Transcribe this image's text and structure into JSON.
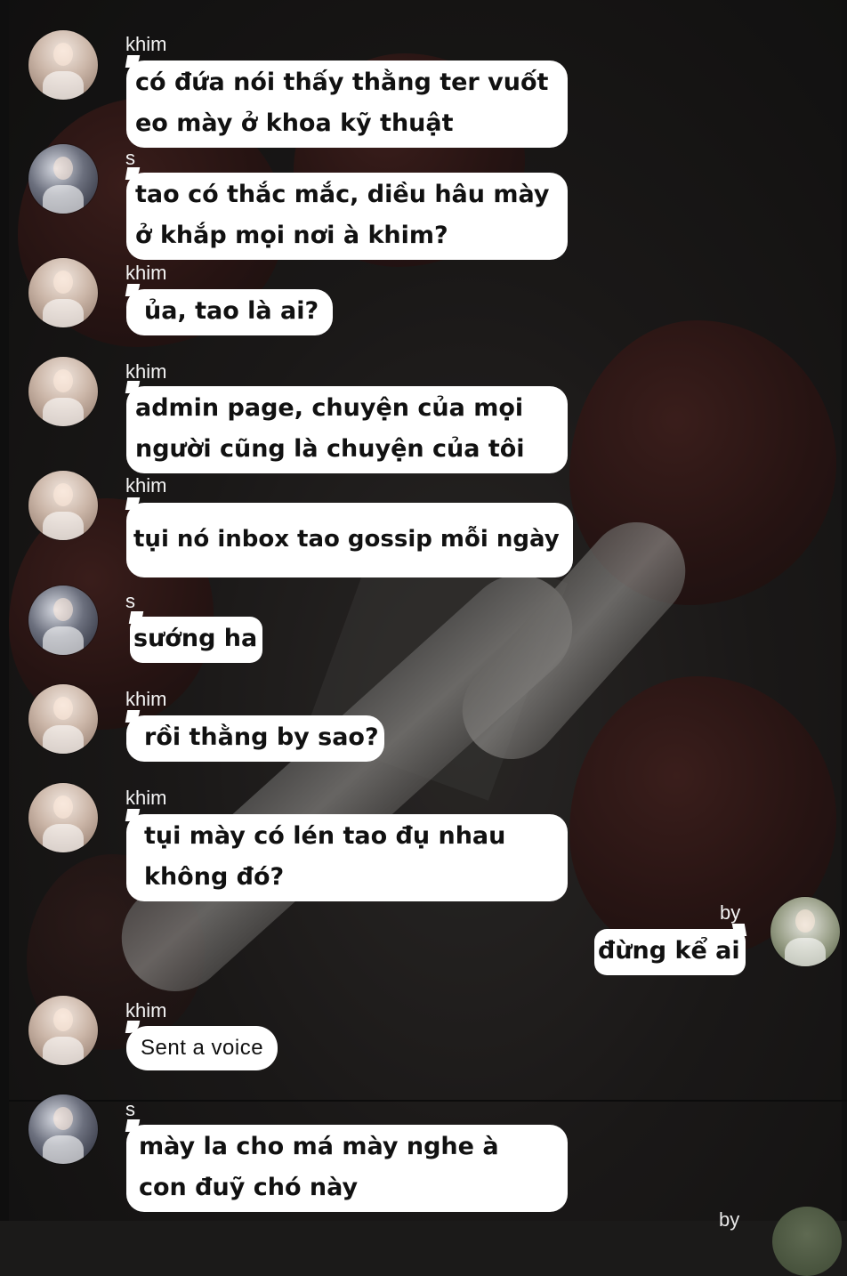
{
  "chat": {
    "messages": [
      {
        "sender": "khim",
        "avatar_icon": "khim-avatar-icon",
        "text": "có đứa nói thấy thằng ter vuốt eo mày ở khoa kỹ thuật",
        "side": "left"
      },
      {
        "sender": "s",
        "avatar_icon": "s-avatar-icon",
        "text": "tao có thắc mắc, diều hâu mày ở khắp mọi nơi à khim?",
        "side": "left"
      },
      {
        "sender": "khim",
        "avatar_icon": "khim-avatar-icon",
        "text": "ủa, tao là ai?",
        "side": "left"
      },
      {
        "sender": "khim",
        "avatar_icon": "khim-avatar-icon",
        "text": "admin page, chuyện của mọi người cũng là chuyện của tôi",
        "side": "left"
      },
      {
        "sender": "khim",
        "avatar_icon": "khim-avatar-icon",
        "text": "tụi nó inbox tao gossip mỗi ngày",
        "side": "left"
      },
      {
        "sender": "s",
        "avatar_icon": "s-avatar-icon",
        "text": "sướng ha",
        "side": "left"
      },
      {
        "sender": "khim",
        "avatar_icon": "khim-avatar-icon",
        "text": "rồi thằng by sao?",
        "side": "left"
      },
      {
        "sender": "khim",
        "avatar_icon": "khim-avatar-icon",
        "text": "tụi mày có lén tao đụ nhau không đó?",
        "side": "left"
      },
      {
        "sender": "by",
        "avatar_icon": "by-avatar-icon",
        "text": "đừng kể ai",
        "side": "right"
      },
      {
        "sender": "khim",
        "avatar_icon": "khim-avatar-icon",
        "text": "Sent a voice",
        "side": "left",
        "type": "voice"
      },
      {
        "sender": "s",
        "avatar_icon": "s-avatar-icon",
        "text": "mày la cho má mày nghe à con đuỹ chó này",
        "side": "left"
      }
    ],
    "next_sender_partial": "by"
  }
}
